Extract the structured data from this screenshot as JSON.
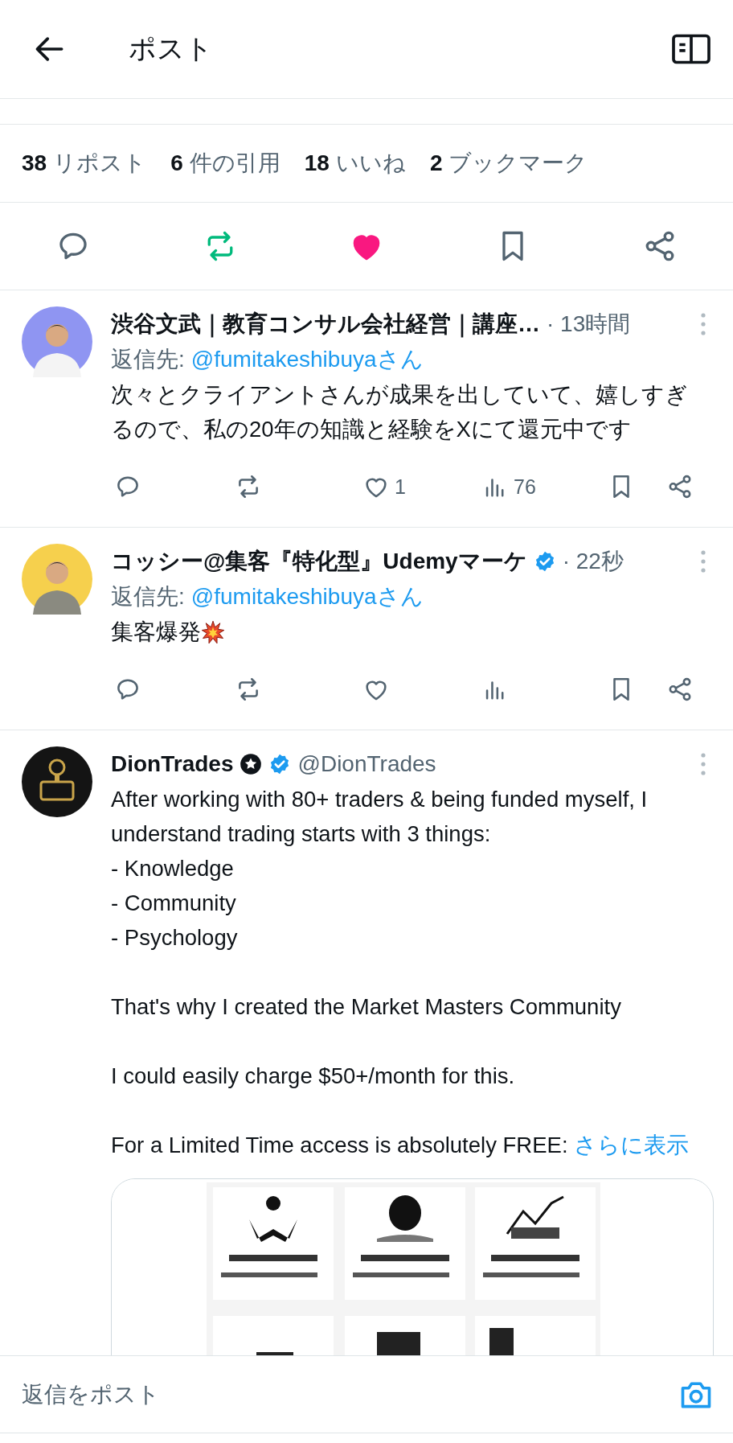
{
  "header": {
    "title": "ポスト"
  },
  "stats": [
    {
      "count": "38",
      "label": "リポスト"
    },
    {
      "count": "6",
      "label": "件の引用"
    },
    {
      "count": "18",
      "label": "いいね"
    },
    {
      "count": "2",
      "label": "ブックマーク"
    }
  ],
  "actions": {
    "reposted": true,
    "liked": true,
    "bookmarked": false
  },
  "posts": [
    {
      "avatar": {
        "kind": "picture"
      },
      "name": "渋谷文武｜教育コンサル会社経営｜講座…",
      "time": "· 13時間",
      "reply_label": "返信先:",
      "reply_to": "@fumitakeshibuyaさん",
      "text": "次々とクライアントさんが成果を出していて、嬉しすぎるので、私の20年の知識と経験をXにて還元中です",
      "actions": [
        {
          "kind": "reply"
        },
        {
          "kind": "repost"
        },
        {
          "kind": "like",
          "count": "1"
        },
        {
          "kind": "views",
          "count": "76"
        },
        {
          "kind": "bookmark"
        },
        {
          "kind": "share"
        }
      ]
    },
    {
      "avatar": {
        "kind": "picture"
      },
      "name": "コッシー@集客『特化型』Udemyマーケ",
      "badges": [
        {
          "kind": "verified"
        }
      ],
      "time": "· 22秒",
      "reply_label": "返信先:",
      "reply_to": "@fumitakeshibuyaさん",
      "text": "集客爆発",
      "text_icon": {
        "kind": "explosion"
      },
      "actions": [
        {
          "kind": "reply"
        },
        {
          "kind": "repost"
        },
        {
          "kind": "like"
        },
        {
          "kind": "views"
        },
        {
          "kind": "bookmark"
        },
        {
          "kind": "share"
        }
      ]
    },
    {
      "avatar": {
        "kind": "picture"
      },
      "name": "DionTrades",
      "badges": [
        {
          "kind": "star"
        },
        {
          "kind": "verified"
        }
      ],
      "handle": "@DionTrades",
      "text": "After working with 80+ traders & being funded myself, I understand trading starts with 3 things:\n- Knowledge\n- Community\n- Psychology\n\nThat's why I created the Market Masters Community\n\nI could easily charge $50+/month for this.\n\nFor a Limited Time access is absolutely FREE: ",
      "show_more": "さらに表示",
      "card": {
        "kind": "picture"
      }
    }
  ],
  "footer": {
    "placeholder": "返信をポスト"
  }
}
